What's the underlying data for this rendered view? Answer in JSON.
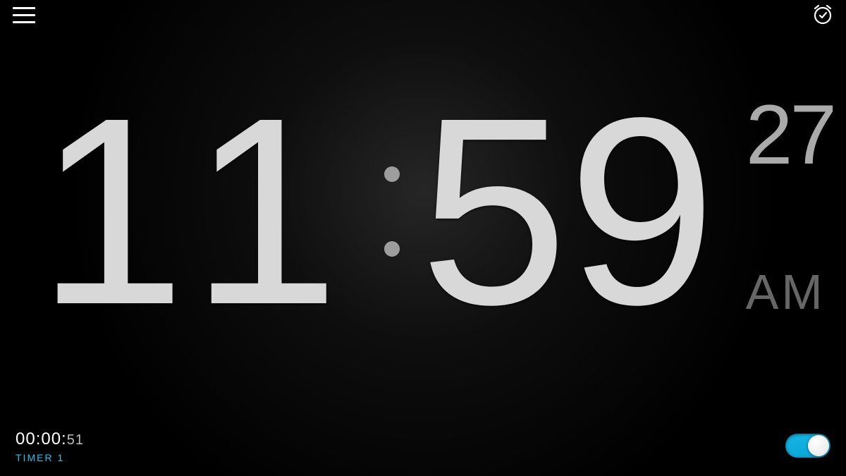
{
  "colors": {
    "accent": "#1ec2e6"
  },
  "clock": {
    "hours": "11",
    "minutes": "59",
    "seconds": "27",
    "ampm": "AM"
  },
  "timer": {
    "value_main": "00:00:",
    "value_sec": "51",
    "label": "TIMER 1",
    "enabled": true
  }
}
